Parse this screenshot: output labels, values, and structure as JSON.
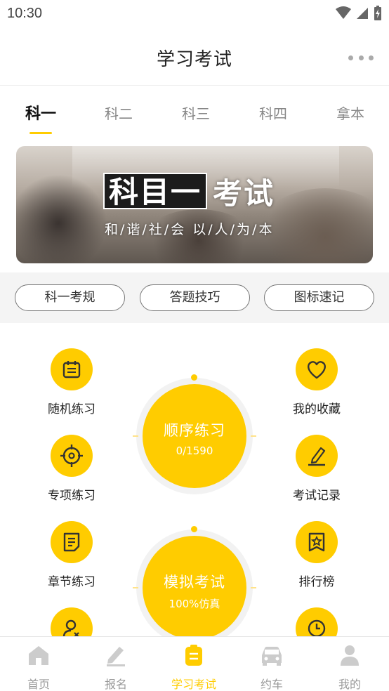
{
  "status_bar": {
    "time": "10:30"
  },
  "header": {
    "title": "学习考试"
  },
  "tabs": [
    {
      "label": "科一",
      "active": true
    },
    {
      "label": "科二",
      "active": false
    },
    {
      "label": "科三",
      "active": false
    },
    {
      "label": "科四",
      "active": false
    },
    {
      "label": "拿本",
      "active": false
    }
  ],
  "banner": {
    "title_box": "科目一",
    "title_rest": "考试",
    "subtitle": "和/谐/社/会 以/人/为/本"
  },
  "pills": [
    "科一考规",
    "答题技巧",
    "图标速记"
  ],
  "left_items": [
    {
      "label": "随机练习",
      "icon": "calendar-icon"
    },
    {
      "label": "专项练习",
      "icon": "target-icon"
    },
    {
      "label": "章节练习",
      "icon": "document-icon"
    },
    {
      "label": "",
      "icon": "user-error-icon"
    }
  ],
  "right_items": [
    {
      "label": "我的收藏",
      "icon": "heart-icon"
    },
    {
      "label": "考试记录",
      "icon": "edit-icon"
    },
    {
      "label": "排行榜",
      "icon": "ranking-icon"
    },
    {
      "label": "",
      "icon": "clock-icon"
    }
  ],
  "practice_circle": {
    "title": "顺序练习",
    "progress": "0/1590"
  },
  "exam_circle": {
    "title": "模拟考试",
    "subtitle": "100%仿真"
  },
  "bottom_nav": [
    {
      "label": "首页",
      "icon": "home-icon",
      "active": false
    },
    {
      "label": "报名",
      "icon": "signup-icon",
      "active": false
    },
    {
      "label": "学习考试",
      "icon": "study-icon",
      "active": true
    },
    {
      "label": "约车",
      "icon": "car-icon",
      "active": false
    },
    {
      "label": "我的",
      "icon": "profile-icon",
      "active": false
    }
  ],
  "colors": {
    "accent": "#ffcc00",
    "inactive": "#999999",
    "icon_grey": "#cccccc"
  }
}
